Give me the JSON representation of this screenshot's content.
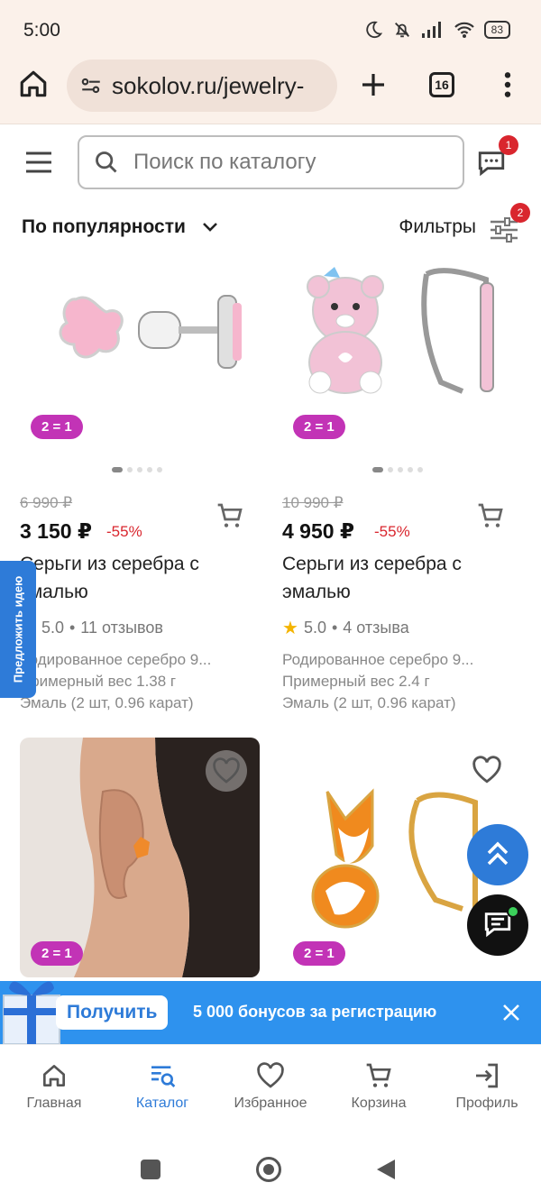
{
  "status_bar": {
    "time": "5:00",
    "battery": "83"
  },
  "browser": {
    "url": "sokolov.ru/jewelry-",
    "tab_count": "16"
  },
  "header": {
    "search_placeholder": "Поиск по каталогу",
    "chat_badge": "1"
  },
  "sort": {
    "label": "По популярности",
    "filters_label": "Фильтры",
    "filters_badge": "2"
  },
  "products": [
    {
      "promo": "2 = 1",
      "old_price": "6 990 ₽",
      "price": "3 150 ₽",
      "discount": "-55%",
      "name": "Серьги из серебра с эмалью",
      "rating": "5.0",
      "reviews": "11 отзывов",
      "desc": [
        "Родированное серебро 9...",
        "Примерный вес 1.38 г",
        "Эмаль (2 шт, 0.96 карат)"
      ]
    },
    {
      "promo": "2 = 1",
      "old_price": "10 990 ₽",
      "price": "4 950 ₽",
      "discount": "-55%",
      "name": "Серьги из серебра с эмалью",
      "rating": "5.0",
      "reviews": "4 отзыва",
      "desc": [
        "Родированное серебро 9...",
        "Примерный вес 2.4 г",
        "Эмаль (2 шт, 0.96 карат)"
      ]
    },
    {
      "promo": "2 = 1"
    },
    {
      "promo": "2 = 1"
    }
  ],
  "side_tab": "Предложить идею",
  "banner": {
    "button": "Получить",
    "text": "5 000 бонусов за регистрацию"
  },
  "bottom_nav": [
    {
      "label": "Главная",
      "icon": "home-icon"
    },
    {
      "label": "Каталог",
      "icon": "catalog-search-icon",
      "active": true
    },
    {
      "label": "Избранное",
      "icon": "heart-icon"
    },
    {
      "label": "Корзина",
      "icon": "cart-icon"
    },
    {
      "label": "Профиль",
      "icon": "login-icon"
    }
  ],
  "colors": {
    "accent": "#2e7bd8",
    "promo": "#c233b6",
    "discount": "#d9262e",
    "banner": "#2e92ee"
  }
}
